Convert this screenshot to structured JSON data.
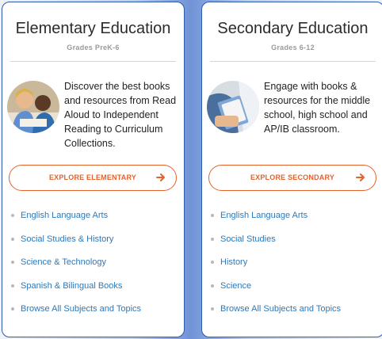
{
  "elementary": {
    "title": "Elementary Education",
    "grades": "Grades PreK-6",
    "blurb": "Discover the best books and resources from Read Aloud to Independent Reading to Curriculum Collections.",
    "button_label": "EXPLORE ELEMENTARY",
    "links": [
      "English Language Arts",
      "Social Studies & History",
      "Science & Technology",
      "Spanish & Bilingual Books",
      "Browse All Subjects and Topics"
    ]
  },
  "secondary": {
    "title": "Secondary Education",
    "grades": "Grades 6-12",
    "blurb": "Engage with books & resources for the middle school, high school and AP/IB classroom.",
    "button_label": "EXPLORE SECONDARY",
    "links": [
      "English Language Arts",
      "Social Studies",
      "History",
      "Science",
      "Browse All Subjects and Topics"
    ]
  },
  "icons": {
    "arrow": "arrow-right-icon",
    "bullet": "bullet-dot"
  },
  "colors": {
    "accent": "#e5622b",
    "link": "#2e78b8",
    "card_border": "#2e5aa8"
  }
}
